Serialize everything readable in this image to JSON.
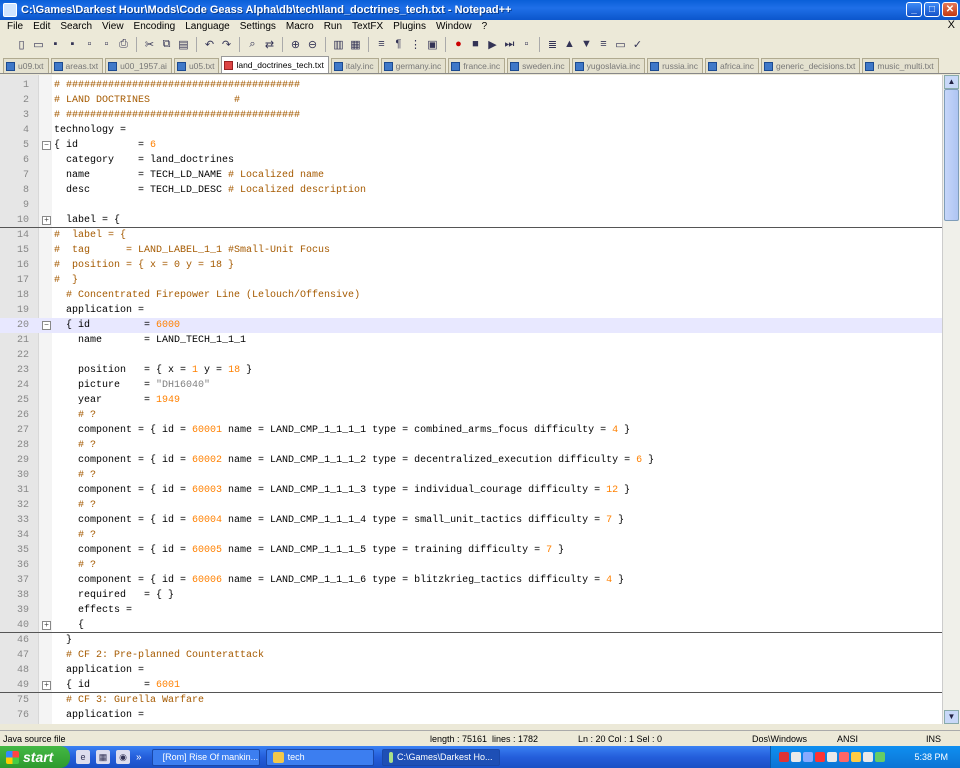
{
  "window": {
    "title": "C:\\Games\\Darkest Hour\\Mods\\Code Geass Alpha\\db\\tech\\land_doctrines_tech.txt - Notepad++"
  },
  "menubar": {
    "items": [
      "File",
      "Edit",
      "Search",
      "View",
      "Encoding",
      "Language",
      "Settings",
      "Macro",
      "Run",
      "TextFX",
      "Plugins",
      "Window",
      "?"
    ],
    "close": "X"
  },
  "tabs": [
    {
      "label": "u09.txt",
      "active": false
    },
    {
      "label": "areas.txt",
      "active": false
    },
    {
      "label": "u00_1957.ai",
      "active": false
    },
    {
      "label": "u05.txt",
      "active": false
    },
    {
      "label": "land_doctrines_tech.txt",
      "active": true
    },
    {
      "label": "italy.inc",
      "active": false
    },
    {
      "label": "germany.inc",
      "active": false
    },
    {
      "label": "france.inc",
      "active": false
    },
    {
      "label": "sweden.inc",
      "active": false
    },
    {
      "label": "yugoslavia.inc",
      "active": false
    },
    {
      "label": "russia.inc",
      "active": false
    },
    {
      "label": "africa.inc",
      "active": false
    },
    {
      "label": "generic_decisions.txt",
      "active": false
    },
    {
      "label": "music_multi.txt",
      "active": false
    }
  ],
  "lines": [
    {
      "n": "1",
      "t": "# #######################################",
      "f": ""
    },
    {
      "n": "2",
      "t": "# LAND DOCTRINES              #",
      "f": ""
    },
    {
      "n": "3",
      "t": "# #######################################",
      "f": ""
    },
    {
      "n": "4",
      "t": "technology =",
      "f": ""
    },
    {
      "n": "5",
      "t": "{ id          = 6",
      "f": "minus"
    },
    {
      "n": "6",
      "t": "  category    = land_doctrines",
      "f": ""
    },
    {
      "n": "7",
      "t": "  name        = TECH_LD_NAME # Localized name",
      "f": ""
    },
    {
      "n": "8",
      "t": "  desc        = TECH_LD_DESC # Localized description",
      "f": ""
    },
    {
      "n": "9",
      "t": "",
      "f": ""
    },
    {
      "n": "10",
      "t": "  label = {",
      "f": "plus",
      "sep": true
    },
    {
      "n": "14",
      "t": "#  label = {",
      "f": ""
    },
    {
      "n": "15",
      "t": "#  tag      = LAND_LABEL_1_1 #Small-Unit Focus",
      "f": ""
    },
    {
      "n": "16",
      "t": "#  position = { x = 0 y = 18 }",
      "f": ""
    },
    {
      "n": "17",
      "t": "#  }",
      "f": ""
    },
    {
      "n": "18",
      "t": "  # Concentrated Firepower Line (Lelouch/Offensive)",
      "f": ""
    },
    {
      "n": "19",
      "t": "  application =",
      "f": ""
    },
    {
      "n": "20",
      "t": "  { id         = 6000",
      "f": "minus",
      "cur": true
    },
    {
      "n": "21",
      "t": "    name       = LAND_TECH_1_1_1",
      "f": ""
    },
    {
      "n": "22",
      "t": "",
      "f": ""
    },
    {
      "n": "23",
      "t": "    position   = { x = 1 y = 18 }",
      "f": ""
    },
    {
      "n": "24",
      "t": "    picture    = \"DH16040\"",
      "f": ""
    },
    {
      "n": "25",
      "t": "    year       = 1949",
      "f": ""
    },
    {
      "n": "26",
      "t": "    # ?",
      "f": ""
    },
    {
      "n": "27",
      "t": "    component = { id = 60001 name = LAND_CMP_1_1_1_1 type = combined_arms_focus difficulty = 4 }",
      "f": ""
    },
    {
      "n": "28",
      "t": "    # ?",
      "f": ""
    },
    {
      "n": "29",
      "t": "    component = { id = 60002 name = LAND_CMP_1_1_1_2 type = decentralized_execution difficulty = 6 }",
      "f": ""
    },
    {
      "n": "30",
      "t": "    # ?",
      "f": ""
    },
    {
      "n": "31",
      "t": "    component = { id = 60003 name = LAND_CMP_1_1_1_3 type = individual_courage difficulty = 12 }",
      "f": ""
    },
    {
      "n": "32",
      "t": "    # ?",
      "f": ""
    },
    {
      "n": "33",
      "t": "    component = { id = 60004 name = LAND_CMP_1_1_1_4 type = small_unit_tactics difficulty = 7 }",
      "f": ""
    },
    {
      "n": "34",
      "t": "    # ?",
      "f": ""
    },
    {
      "n": "35",
      "t": "    component = { id = 60005 name = LAND_CMP_1_1_1_5 type = training difficulty = 7 }",
      "f": ""
    },
    {
      "n": "36",
      "t": "    # ?",
      "f": ""
    },
    {
      "n": "37",
      "t": "    component = { id = 60006 name = LAND_CMP_1_1_1_6 type = blitzkrieg_tactics difficulty = 4 }",
      "f": ""
    },
    {
      "n": "38",
      "t": "    required   = { }",
      "f": ""
    },
    {
      "n": "39",
      "t": "    effects =",
      "f": ""
    },
    {
      "n": "40",
      "t": "    {",
      "f": "plus",
      "sep": true
    },
    {
      "n": "46",
      "t": "  }",
      "f": ""
    },
    {
      "n": "47",
      "t": "  # CF 2: Pre-planned Counterattack",
      "f": ""
    },
    {
      "n": "48",
      "t": "  application =",
      "f": ""
    },
    {
      "n": "49",
      "t": "  { id         = 6001",
      "f": "plus",
      "sep": true
    },
    {
      "n": "75",
      "t": "  # CF 3: Gurella Warfare",
      "f": ""
    },
    {
      "n": "76",
      "t": "  application =",
      "f": ""
    }
  ],
  "status": {
    "type": "Java source file",
    "length": "length : 75161",
    "lines": "lines : 1782",
    "pos": "Ln : 20   Col : 1   Sel : 0",
    "eol": "Dos\\Windows",
    "enc": "ANSI",
    "mode": "INS"
  },
  "taskbar": {
    "start": "start",
    "chevron": "»",
    "tasks": [
      {
        "label": "[Rom] Rise Of mankin...",
        "active": false
      },
      {
        "label": "tech",
        "active": false
      },
      {
        "label": "C:\\Games\\Darkest Ho...",
        "active": true
      }
    ],
    "clock": "5:38 PM"
  }
}
